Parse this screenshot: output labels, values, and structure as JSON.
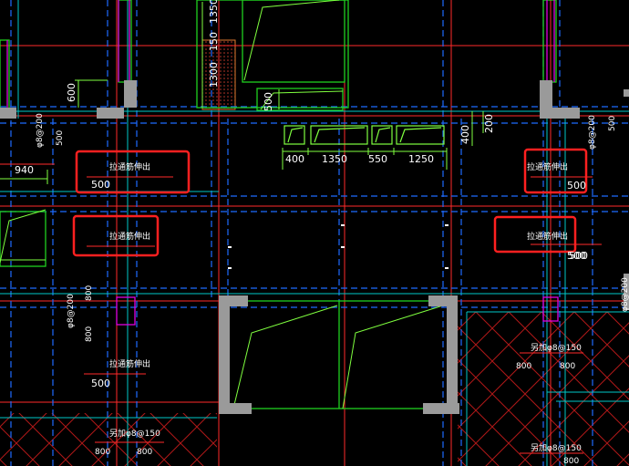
{
  "colors": {
    "background": "#000000",
    "axis_red": "#ff2a2a",
    "grid_cyan": "#00c8c8",
    "dash_blue": "#1e6bff",
    "wall_green": "#20d020",
    "dim_green": "#7fff3f",
    "column_gray": "#9a9a9a",
    "magenta": "#e000e0",
    "highlight_box": "#ff2020",
    "hatch_red": "#b01818",
    "text": "#ffffff"
  },
  "dimensions": {
    "top": [
      "400",
      "1350",
      "550",
      "1250"
    ],
    "side_200": "200",
    "side_400": "400",
    "left_940": "940",
    "v_1350": "1350",
    "v_150": "150",
    "v_1300": "1300",
    "v_500_center": "500",
    "v_600": "600"
  },
  "rebar_labels": {
    "left_upper": "φ8@200",
    "left_upper_500": "500",
    "left_mid": "φ8@200",
    "left_mid_800a": "800",
    "left_mid_800b": "800",
    "right_upper": "φ8@200",
    "right_upper_500": "500",
    "right_mid": "φ8@200",
    "right_mid_500": "500"
  },
  "notes": [
    {
      "text": "拉通筋伸出",
      "value": "500"
    },
    {
      "text": "拉通筋伸出",
      "value": ""
    },
    {
      "text": "拉通筋伸出",
      "value": "500"
    },
    {
      "text": "拉通筋伸出",
      "value": "500"
    },
    {
      "text": "拉通筋伸出",
      "value": "500"
    }
  ],
  "extra_rebar": [
    {
      "text": "另加φ8@150",
      "a": "800",
      "b": "800"
    },
    {
      "text": "另加φ8@150",
      "a": "800",
      "b": "800"
    },
    {
      "text": "另加φ8@150",
      "a": "",
      "b": "800"
    }
  ]
}
